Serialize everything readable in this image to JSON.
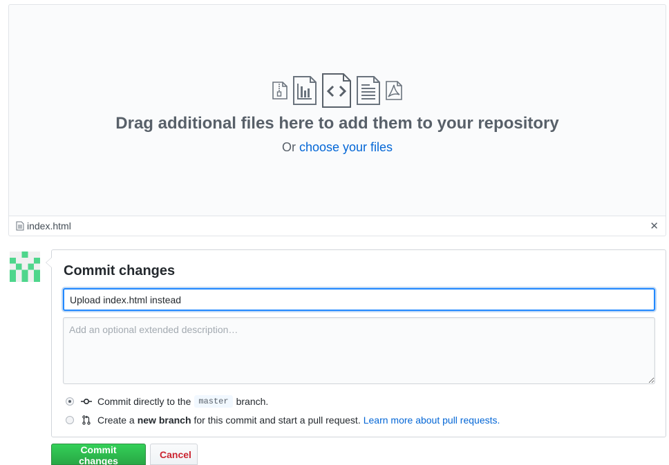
{
  "dropzone": {
    "title": "Drag additional files here to add them to your repository",
    "sub_prefix": "Or",
    "choose_link": "choose your files",
    "icons": [
      "zip-file-icon",
      "chart-file-icon",
      "code-file-icon",
      "text-file-icon",
      "pdf-file-icon"
    ]
  },
  "file_row": {
    "file_name": "index.html",
    "remove_label": "✕"
  },
  "commit": {
    "title": "Commit changes",
    "summary_value": "Upload index.html instead",
    "description_placeholder": "Add an optional extended description…",
    "option_direct": {
      "before": "Commit directly to the",
      "branch": "master",
      "after": "branch."
    },
    "option_new_branch": {
      "before": "Create a",
      "bold": "new branch",
      "after": "for this commit and start a pull request.",
      "link": "Learn more about pull requests."
    }
  },
  "buttons": {
    "commit_label": "Commit changes",
    "cancel_label": "Cancel"
  },
  "colors": {
    "link": "#0366d6",
    "primary_button": "#28a745",
    "danger_text": "#cb2431",
    "focus_border": "#2188ff"
  }
}
